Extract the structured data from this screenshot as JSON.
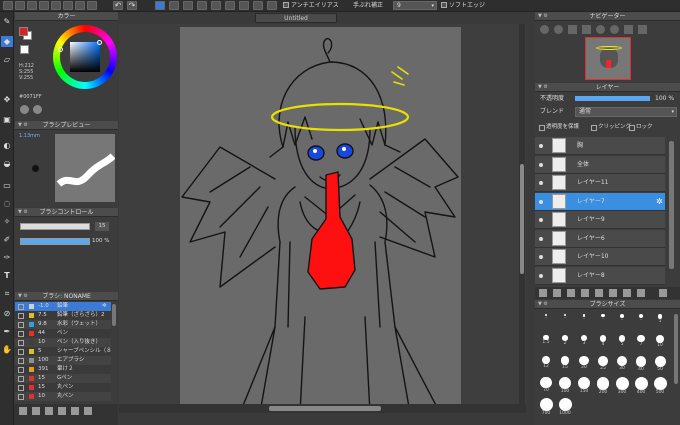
{
  "toolbar": {
    "antialias": "アンチエイリアス",
    "stabilizer_label": "手ぶれ補正",
    "stabilizer_value": "9",
    "soft_edge": "ソフトエッジ"
  },
  "tab": {
    "title": "Untitled"
  },
  "color_panel": {
    "title": "カラー",
    "hsv_h": "H:212",
    "hsv_s": "S:255",
    "hsv_v": "V:255",
    "hex": "#0071FF",
    "fg_color": "#e02020",
    "bg_color": "#ffffff",
    "accent": "#0071ff"
  },
  "brush_preview": {
    "title": "ブラシプレビュー",
    "size": "1.13mm"
  },
  "brush_control": {
    "title": "ブラシコントロール",
    "size_value": "15",
    "opacity_value": "100 %"
  },
  "brush_list": {
    "title": "ブラシ: NONAME",
    "items": [
      {
        "size": "-1.0",
        "name": "鉛筆",
        "color": "#d0d0d0",
        "selected": true
      },
      {
        "size": "7.5",
        "name": "鉛筆（ざらざら）2",
        "color": "#e0c020",
        "selected": false
      },
      {
        "size": "9.8",
        "name": "水彩（ウェット）",
        "color": "#30a0e0",
        "selected": false
      },
      {
        "size": "44",
        "name": "ペン",
        "color": "#e03030",
        "selected": false
      },
      {
        "size": "10",
        "name": "ペン（入り抜き）",
        "color": "#404040",
        "selected": false
      },
      {
        "size": "5",
        "name": "シャープペンシル（８）",
        "color": "#e0c020",
        "selected": false
      },
      {
        "size": "100",
        "name": "エアブラシ",
        "color": "#909090",
        "selected": false
      },
      {
        "size": "391",
        "name": "暈け２",
        "color": "#e0a020",
        "selected": false
      },
      {
        "size": "15",
        "name": "Gペン",
        "color": "#e03030",
        "selected": false
      },
      {
        "size": "15",
        "name": "丸ペン",
        "color": "#e03030",
        "selected": false
      },
      {
        "size": "10",
        "name": "丸ペン",
        "color": "#e03030",
        "selected": false
      }
    ]
  },
  "navigator": {
    "title": "ナビゲーター"
  },
  "layer_panel": {
    "title": "レイヤー",
    "opacity_label": "不透明度",
    "opacity_value": "100 %",
    "opacity_fraction": 1.0,
    "blend_label": "ブレンド",
    "blend_value": "通常",
    "protect_label": "透明度を保護",
    "clipping_label": "クリッピング",
    "lock_label": "ロック",
    "layers": [
      {
        "name": "胸",
        "selected": false
      },
      {
        "name": "全体",
        "selected": false
      },
      {
        "name": "レイヤー11",
        "selected": false
      },
      {
        "name": "レイヤー7",
        "selected": true
      },
      {
        "name": "レイヤー9",
        "selected": false
      },
      {
        "name": "レイヤー6",
        "selected": false
      },
      {
        "name": "レイヤー10",
        "selected": false
      },
      {
        "name": "レイヤー8",
        "selected": false
      }
    ]
  },
  "brush_size_panel": {
    "title": "ブラシサイズ",
    "sizes": [
      "-",
      "-",
      "-",
      "-",
      "-",
      "-",
      "1",
      "1.5",
      "2",
      "3",
      "4",
      "5",
      "7",
      "10",
      "12",
      "15",
      "20",
      "25",
      "30",
      "40",
      "50",
      "70",
      "100",
      "150",
      "200",
      "300",
      "400",
      "500",
      "700",
      "1000"
    ]
  }
}
